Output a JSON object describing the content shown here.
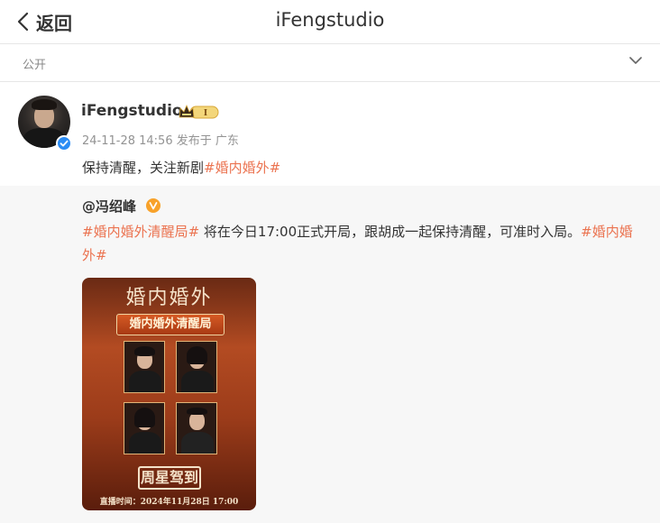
{
  "header": {
    "back_label": "返回",
    "title": "iFengstudio"
  },
  "visibility": {
    "label": "公开"
  },
  "post": {
    "username": "iFengstudio",
    "timestamp": "24-11-28 14:56",
    "location": "发布于 广东",
    "text": "保持清醒，关注新剧",
    "hashtag": "#婚内婚外#"
  },
  "repost": {
    "author": "@冯绍峰",
    "hashtag_1": "#婚内婚外清醒局#",
    "text": " 将在今日17:00正式开局，跟胡成一起保持清醒，可准时入局。",
    "hashtag_2": "#婚内婚外#"
  },
  "poster": {
    "script_title": "婚内婚外",
    "banner": "婚内婚外清醒局",
    "logo": "周星驾到",
    "footer": "直播时间：2024年11月28日 17:00"
  },
  "colors": {
    "accent": "#eb7350",
    "verified_blue": "#2b8cf4",
    "repost_bg": "#f7f7f7"
  }
}
